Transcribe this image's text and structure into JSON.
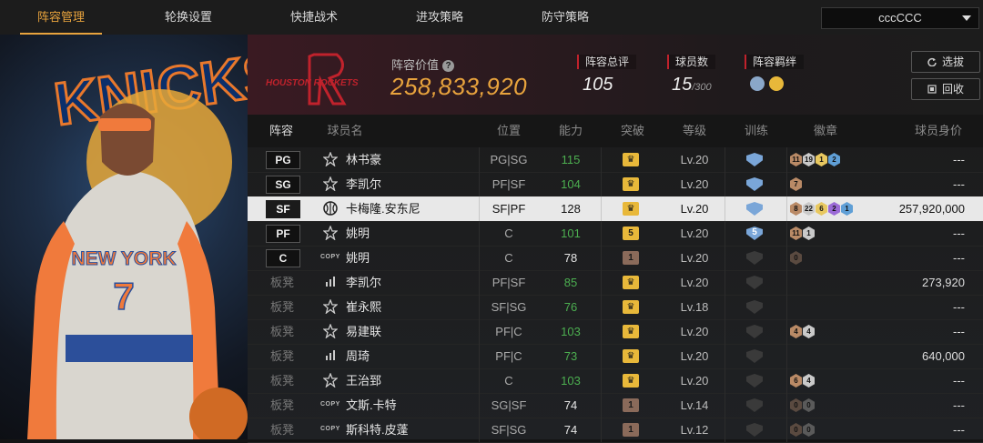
{
  "nav": {
    "tabs": [
      {
        "label": "阵容管理",
        "active": true
      },
      {
        "label": "轮换设置",
        "active": false
      },
      {
        "label": "快捷战术",
        "active": false
      },
      {
        "label": "进攻策略",
        "active": false
      },
      {
        "label": "防守策略",
        "active": false
      }
    ],
    "team_select": "cccCCC"
  },
  "header": {
    "team_logo_text": "HOUSTON ROCKETS",
    "value_label": "阵容价值",
    "value": "258,833,920",
    "overall_label": "阵容总评",
    "overall": "105",
    "count_label": "球员数",
    "count": "15",
    "count_max": "/300",
    "chemistry_label": "阵容羁绊",
    "chemistry_icons": [
      "chem-players-icon",
      "chem-players-gold-icon"
    ],
    "scout_label": "选拔",
    "recycle_label": "回收"
  },
  "player_art": {
    "jersey_text": "NEW YORK",
    "jersey_number": "7",
    "background_text": "KNICKS"
  },
  "table": {
    "headers": [
      "阵容",
      "球员名",
      "位置",
      "能力",
      "突破",
      "等级",
      "训练",
      "徽章",
      "球员身价"
    ],
    "rows": [
      {
        "slot": "PG",
        "is_bench": false,
        "type": "star",
        "name": "林书豪",
        "position": "PG|SG",
        "rating": "115",
        "rating_color": "green",
        "break": "crown",
        "break_color": "#e8b83a",
        "level": "Lv.20",
        "train": "crown-blue",
        "badges": [
          {
            "n": "11",
            "c": "#b98a66"
          },
          {
            "n": "19",
            "c": "#c9c9c9"
          },
          {
            "n": "1",
            "c": "#e8c860"
          },
          {
            "n": "2",
            "c": "#5f9fd6"
          }
        ],
        "price": "---",
        "selected": false
      },
      {
        "slot": "SG",
        "is_bench": false,
        "type": "star",
        "name": "李凯尔",
        "position": "PF|SF",
        "rating": "104",
        "rating_color": "green",
        "break": "crown",
        "break_color": "#e8b83a",
        "level": "Lv.20",
        "train": "crown-blue",
        "badges": [
          {
            "n": "7",
            "c": "#b98a66"
          }
        ],
        "price": "---",
        "selected": false
      },
      {
        "slot": "SF",
        "is_bench": false,
        "type": "ball",
        "name": "卡梅隆.安东尼",
        "position": "SF|PF",
        "rating": "128",
        "rating_color": "white",
        "break": "crown",
        "break_color": "#e8b83a",
        "level": "Lv.20",
        "train": "crown-blue",
        "badges": [
          {
            "n": "8",
            "c": "#b98a66"
          },
          {
            "n": "22",
            "c": "#c9c9c9"
          },
          {
            "n": "6",
            "c": "#e8c860"
          },
          {
            "n": "2",
            "c": "#9b6ad6"
          },
          {
            "n": "1",
            "c": "#5f9fd6"
          }
        ],
        "price": "257,920,000",
        "selected": true
      },
      {
        "slot": "PF",
        "is_bench": false,
        "type": "star",
        "name": "姚明",
        "position": "C",
        "rating": "101",
        "rating_color": "green",
        "break": "5",
        "break_color": "#e8b83a",
        "level": "Lv.20",
        "train": "5-blue",
        "badges": [
          {
            "n": "11",
            "c": "#b98a66"
          },
          {
            "n": "1",
            "c": "#c9c9c9"
          }
        ],
        "price": "---",
        "selected": false
      },
      {
        "slot": "C",
        "is_bench": false,
        "type": "copy",
        "name": "姚明",
        "position": "C",
        "rating": "78",
        "rating_color": "white",
        "break": "1",
        "break_color": "#8a6a5a",
        "level": "Lv.20",
        "train": "grey",
        "badges": [
          {
            "n": "0",
            "c": "#5a4a40"
          }
        ],
        "price": "---",
        "selected": false
      },
      {
        "slot": "板凳",
        "is_bench": true,
        "type": "bars",
        "name": "李凯尔",
        "position": "PF|SF",
        "rating": "85",
        "rating_color": "green",
        "break": "crown",
        "break_color": "#e8b83a",
        "level": "Lv.20",
        "train": "grey",
        "badges": [],
        "price": "273,920",
        "selected": false
      },
      {
        "slot": "板凳",
        "is_bench": true,
        "type": "star",
        "name": "崔永熙",
        "position": "SF|SG",
        "rating": "76",
        "rating_color": "green",
        "break": "crown",
        "break_color": "#e8b83a",
        "level": "Lv.18",
        "train": "grey",
        "badges": [],
        "price": "---",
        "selected": false
      },
      {
        "slot": "板凳",
        "is_bench": true,
        "type": "star",
        "name": "易建联",
        "position": "PF|C",
        "rating": "103",
        "rating_color": "green",
        "break": "crown",
        "break_color": "#e8b83a",
        "level": "Lv.20",
        "train": "grey",
        "badges": [
          {
            "n": "4",
            "c": "#b98a66"
          },
          {
            "n": "4",
            "c": "#c9c9c9"
          }
        ],
        "price": "---",
        "selected": false
      },
      {
        "slot": "板凳",
        "is_bench": true,
        "type": "bars",
        "name": "周琦",
        "position": "PF|C",
        "rating": "73",
        "rating_color": "green",
        "break": "crown",
        "break_color": "#e8b83a",
        "level": "Lv.20",
        "train": "grey",
        "badges": [],
        "price": "640,000",
        "selected": false
      },
      {
        "slot": "板凳",
        "is_bench": true,
        "type": "star",
        "name": "王治郅",
        "position": "C",
        "rating": "103",
        "rating_color": "green",
        "break": "crown",
        "break_color": "#e8b83a",
        "level": "Lv.20",
        "train": "grey",
        "badges": [
          {
            "n": "6",
            "c": "#b98a66"
          },
          {
            "n": "4",
            "c": "#c9c9c9"
          }
        ],
        "price": "---",
        "selected": false
      },
      {
        "slot": "板凳",
        "is_bench": true,
        "type": "copy",
        "name": "文斯.卡特",
        "position": "SG|SF",
        "rating": "74",
        "rating_color": "white",
        "break": "1",
        "break_color": "#8a6a5a",
        "level": "Lv.14",
        "train": "grey",
        "badges": [
          {
            "n": "0",
            "c": "#5a4a40"
          },
          {
            "n": "0",
            "c": "#5a5a5a"
          }
        ],
        "price": "---",
        "selected": false
      },
      {
        "slot": "板凳",
        "is_bench": true,
        "type": "copy",
        "name": "斯科特.皮蓬",
        "position": "SF|SG",
        "rating": "74",
        "rating_color": "white",
        "break": "1",
        "break_color": "#8a6a5a",
        "level": "Lv.12",
        "train": "grey",
        "badges": [
          {
            "n": "0",
            "c": "#5a4a40"
          },
          {
            "n": "0",
            "c": "#5a5a5a"
          }
        ],
        "price": "---",
        "selected": false
      }
    ]
  },
  "colors": {
    "accent": "#e8a33d",
    "red_tag": "#c0222c",
    "green": "#4caf50",
    "selected_row": "#e8e8e8"
  }
}
